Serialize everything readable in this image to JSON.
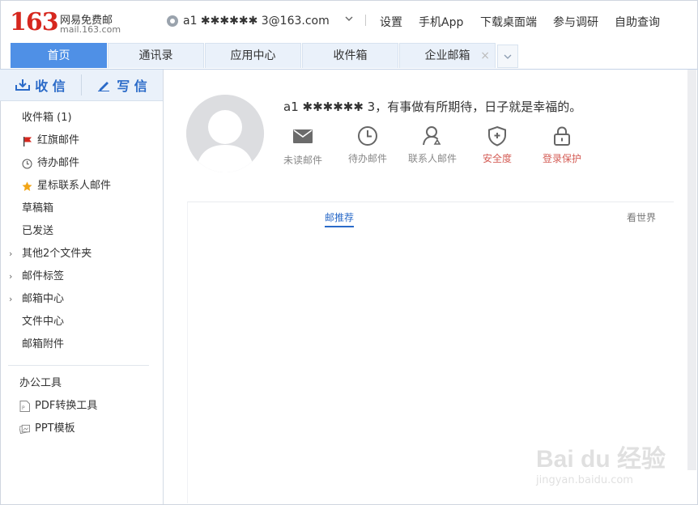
{
  "header": {
    "logo_number": "163",
    "logo_text": "网易免费邮",
    "logo_url": "mail.163.com",
    "account": "a1 ✱✱✱✱✱✱ 3@163.com",
    "nav": [
      "设置",
      "手机App",
      "下载桌面端",
      "参与调研",
      "自助查询"
    ]
  },
  "tabs": [
    {
      "label": "首页",
      "active": true
    },
    {
      "label": "通讯录"
    },
    {
      "label": "应用中心"
    },
    {
      "label": "收件箱"
    },
    {
      "label": "企业邮箱",
      "close": "×"
    }
  ],
  "sidebar": {
    "receive_label": "收 信",
    "compose_label": "写 信",
    "folders": [
      {
        "label": "收件箱 (1)"
      },
      {
        "label": "红旗邮件",
        "icon": "red-flag-icon"
      },
      {
        "label": "待办邮件",
        "icon": "clock-icon"
      },
      {
        "label": "星标联系人邮件",
        "icon": "star-icon"
      },
      {
        "label": "草稿箱"
      },
      {
        "label": "已发送"
      },
      {
        "label": "其他2个文件夹",
        "caret": "›"
      },
      {
        "label": "邮件标签",
        "caret": "›"
      },
      {
        "label": "邮箱中心",
        "caret": "›"
      },
      {
        "label": "文件中心"
      },
      {
        "label": "邮箱附件"
      }
    ],
    "tools_title": "办公工具",
    "tools": [
      {
        "label": "PDF转换工具",
        "icon": "pdf-file-icon"
      },
      {
        "label": "PPT模板",
        "icon": "ppt-template-icon"
      }
    ]
  },
  "main": {
    "greeting": "a1 ✱✱✱✱✱✱ 3，有事做有所期待，日子就是幸福的。",
    "quick_actions": [
      {
        "label": "未读邮件",
        "icon": "envelope-icon"
      },
      {
        "label": "待办邮件",
        "icon": "clock-icon"
      },
      {
        "label": "联系人邮件",
        "icon": "contact-icon"
      },
      {
        "label": "安全度",
        "icon": "shield-icon",
        "warn": true
      },
      {
        "label": "登录保护",
        "icon": "lock-icon",
        "warn": true
      }
    ],
    "feed_tabs": [
      {
        "label": "邮推荐",
        "active": true
      },
      {
        "label": "看世界"
      }
    ]
  },
  "colors": {
    "brand_red": "#d6271e",
    "tab_active": "#4f90e6",
    "link_blue": "#2a6ac8",
    "warn": "#d45d56"
  },
  "watermark": {
    "main": "Bai du 经验",
    "sub": "jingyan.baidu.com"
  }
}
